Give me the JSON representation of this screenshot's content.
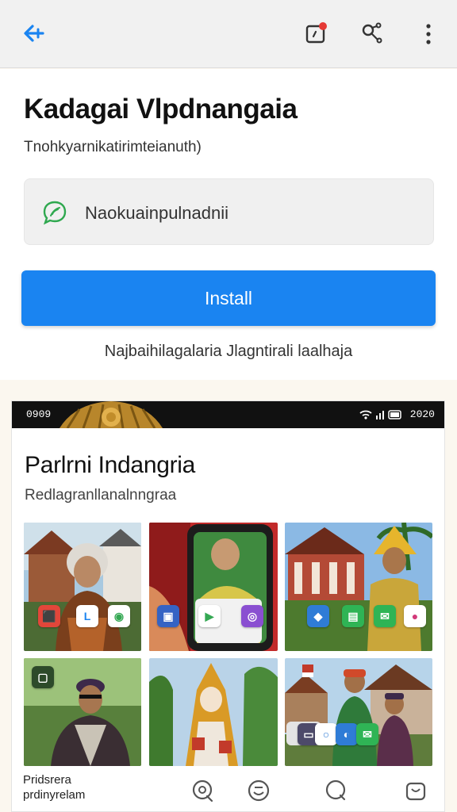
{
  "topbar": {
    "back_icon": "back-arrow-icon",
    "notification_icon": "notification-icon",
    "share_icon": "share-icon",
    "more_icon": "more-vertical-icon",
    "accent": "#1a84f1",
    "badge_color": "#e53935"
  },
  "app": {
    "title": "Kadagai Vlpdnangaia",
    "subtitle": "Tnohkyarnikatirimteianuth)",
    "search_text": "Naokuainpulnadnii",
    "search_icon": "leaf-chat-icon",
    "install_label": "Install",
    "install_color": "#1a84f1",
    "note": "Najbaihilagalaria  Jlagntirali laalhaja"
  },
  "screenshot": {
    "status_left": "0909",
    "status_right": "2020",
    "title": "Parlrni Indangria",
    "subtitle": "Redlagranllanalnngraa",
    "bottom_label_line1": "Pridsrera",
    "bottom_label_line2": "prdinyrelam",
    "bottom_icons": [
      "chat-icon",
      "smile-icon",
      "search-chat-icon",
      "bag-icon"
    ],
    "tiles": [
      "tile-woman-headscarf",
      "tile-phone-in-hand",
      "tile-man-waving-traditional-hat",
      "tile-man-black-cap",
      "tile-traditional-costume",
      "tile-people-village"
    ]
  }
}
